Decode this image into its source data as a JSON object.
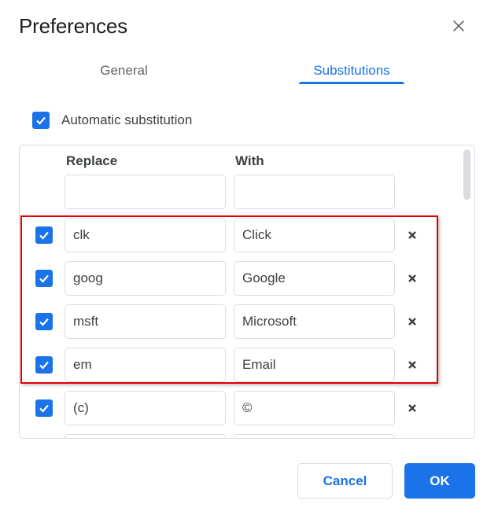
{
  "dialog": {
    "title": "Preferences",
    "close_icon": "close-icon"
  },
  "tabs": [
    {
      "label": "General",
      "active": false
    },
    {
      "label": "Substitutions",
      "active": true
    }
  ],
  "automatic_substitution": {
    "label": "Automatic substitution",
    "checked": true
  },
  "table": {
    "columns": {
      "replace": "Replace",
      "with": "With"
    },
    "new_entry": {
      "replace": "",
      "with": ""
    },
    "rows": [
      {
        "checked": true,
        "replace": "clk",
        "with": "Click"
      },
      {
        "checked": true,
        "replace": "goog",
        "with": "Google"
      },
      {
        "checked": true,
        "replace": "msft",
        "with": "Microsoft"
      },
      {
        "checked": true,
        "replace": "em",
        "with": "Email"
      },
      {
        "checked": true,
        "replace": "(c)",
        "with": "©"
      },
      {
        "checked": true,
        "replace": "",
        "with": ""
      }
    ],
    "highlighted_rows": [
      0,
      1,
      2,
      3
    ]
  },
  "footer": {
    "cancel_label": "Cancel",
    "ok_label": "OK"
  },
  "colors": {
    "accent": "#1a73e8",
    "highlight_border": "#e00000",
    "border": "#dadce0"
  }
}
